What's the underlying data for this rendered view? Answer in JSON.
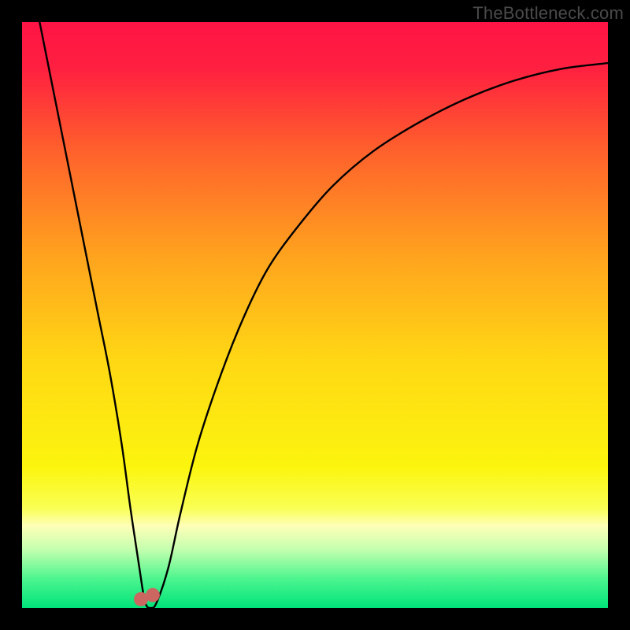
{
  "watermark": "TheBottleneck.com",
  "chart_data": {
    "type": "line",
    "title": "",
    "xlabel": "",
    "ylabel": "",
    "xlim": [
      0,
      100
    ],
    "ylim": [
      0,
      100
    ],
    "grid": false,
    "legend": false,
    "background_gradient": {
      "direction": "top-to-bottom",
      "stops": [
        {
          "pct": 0,
          "color": "#ff1445"
        },
        {
          "pct": 8,
          "color": "#ff2040"
        },
        {
          "pct": 22,
          "color": "#ff612c"
        },
        {
          "pct": 40,
          "color": "#ffa31e"
        },
        {
          "pct": 58,
          "color": "#ffd814"
        },
        {
          "pct": 76,
          "color": "#fbf50e"
        },
        {
          "pct": 83,
          "color": "#f9ff55"
        },
        {
          "pct": 86,
          "color": "#feffb8"
        },
        {
          "pct": 90,
          "color": "#c4ffae"
        },
        {
          "pct": 95,
          "color": "#4df58f"
        },
        {
          "pct": 100,
          "color": "#00e37a"
        }
      ]
    },
    "series": [
      {
        "name": "bottleneck-curve",
        "type": "line",
        "color": "#000000",
        "x": [
          3,
          5,
          7,
          9,
          11,
          13,
          15,
          17,
          18.5,
          20,
          21,
          22,
          23,
          25,
          27,
          30,
          34,
          38,
          42,
          47,
          53,
          60,
          68,
          76,
          84,
          92,
          100
        ],
        "values": [
          100,
          90,
          80,
          70,
          60,
          50,
          40,
          28,
          17,
          7,
          1,
          0,
          1,
          7,
          16,
          28,
          40,
          50,
          58,
          65,
          72,
          78,
          83,
          87,
          90,
          92,
          93
        ]
      },
      {
        "name": "dip-marker",
        "type": "scatter",
        "color": "#cc6660",
        "marker_size": 18,
        "x": [
          20.3,
          22.3
        ],
        "values": [
          1.5,
          2.2
        ]
      }
    ],
    "annotations": []
  }
}
